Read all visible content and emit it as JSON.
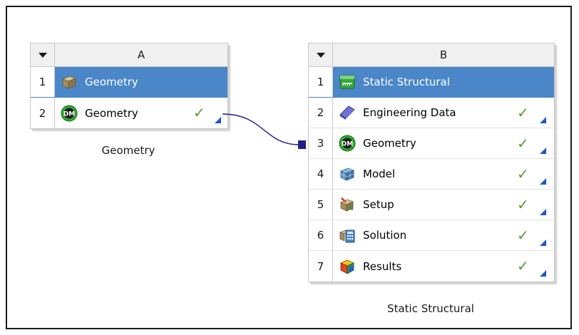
{
  "systems": [
    {
      "letter": "A",
      "caption": "Geometry",
      "rows": [
        {
          "num": "1",
          "label": "Geometry",
          "icon": "geometry-box-icon",
          "selected": true,
          "status": ""
        },
        {
          "num": "2",
          "label": "Geometry",
          "icon": "designmodeler-icon",
          "selected": false,
          "status": "up-to-date"
        }
      ]
    },
    {
      "letter": "B",
      "caption": "Static Structural",
      "rows": [
        {
          "num": "1",
          "label": "Static Structural",
          "icon": "static-structural-icon",
          "selected": true,
          "status": ""
        },
        {
          "num": "2",
          "label": "Engineering Data",
          "icon": "engineering-data-icon",
          "selected": false,
          "status": "up-to-date"
        },
        {
          "num": "3",
          "label": "Geometry",
          "icon": "designmodeler-icon",
          "selected": false,
          "status": "up-to-date"
        },
        {
          "num": "4",
          "label": "Model",
          "icon": "model-mesh-icon",
          "selected": false,
          "status": "up-to-date"
        },
        {
          "num": "5",
          "label": "Setup",
          "icon": "setup-icon",
          "selected": false,
          "status": "up-to-date"
        },
        {
          "num": "6",
          "label": "Solution",
          "icon": "solution-icon",
          "selected": false,
          "status": "up-to-date"
        },
        {
          "num": "7",
          "label": "Results",
          "icon": "results-icon",
          "selected": false,
          "status": "up-to-date"
        }
      ]
    }
  ],
  "icons": {
    "designmodeler_text": "DM",
    "check_glyph": "✓"
  },
  "colors": {
    "selected_row": "#4a86c8",
    "check_green": "#5a9a2c",
    "corner_blue": "#1f56d0",
    "link_line": "#1f1f8a"
  }
}
